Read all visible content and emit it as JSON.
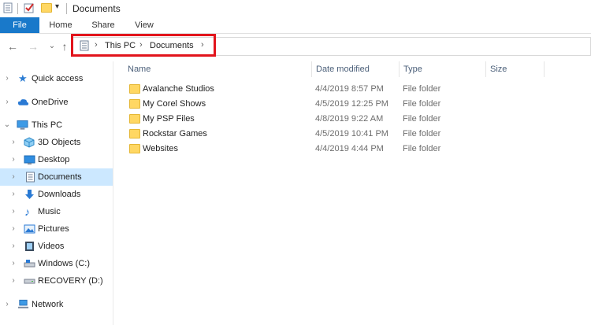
{
  "window": {
    "title": "Documents"
  },
  "ribbon": {
    "file_label": "File",
    "tabs": [
      "Home",
      "Share",
      "View"
    ]
  },
  "address": {
    "crumbs": [
      "This PC",
      "Documents"
    ]
  },
  "columns": {
    "name": "Name",
    "date": "Date modified",
    "type": "Type",
    "size": "Size"
  },
  "nav": {
    "quick_access": "Quick access",
    "onedrive": "OneDrive",
    "this_pc": "This PC",
    "children": [
      "3D Objects",
      "Desktop",
      "Documents",
      "Downloads",
      "Music",
      "Pictures",
      "Videos",
      "Windows (C:)",
      "RECOVERY (D:)"
    ],
    "network": "Network"
  },
  "files": [
    {
      "name": "Avalanche Studios",
      "date": "4/4/2019 8:57 PM",
      "type": "File folder"
    },
    {
      "name": "My Corel Shows",
      "date": "4/5/2019 12:25 PM",
      "type": "File folder"
    },
    {
      "name": "My PSP Files",
      "date": "4/8/2019 9:22 AM",
      "type": "File folder"
    },
    {
      "name": "Rockstar Games",
      "date": "4/5/2019 10:41 PM",
      "type": "File folder"
    },
    {
      "name": "Websites",
      "date": "4/4/2019 4:44 PM",
      "type": "File folder"
    }
  ],
  "colors": {
    "accent": "#1979ca",
    "highlight": "#e2141c",
    "selected": "#cce8ff",
    "folder": "#ffd763"
  },
  "icons": [
    "document-icon",
    "checkmark-icon",
    "folder-icon",
    "quick-access-star-icon",
    "onedrive-cloud-icon",
    "computer-icon",
    "3d-objects-icon",
    "desktop-icon",
    "downloads-icon",
    "music-icon",
    "pictures-icon",
    "videos-icon",
    "drive-icon",
    "network-icon"
  ]
}
